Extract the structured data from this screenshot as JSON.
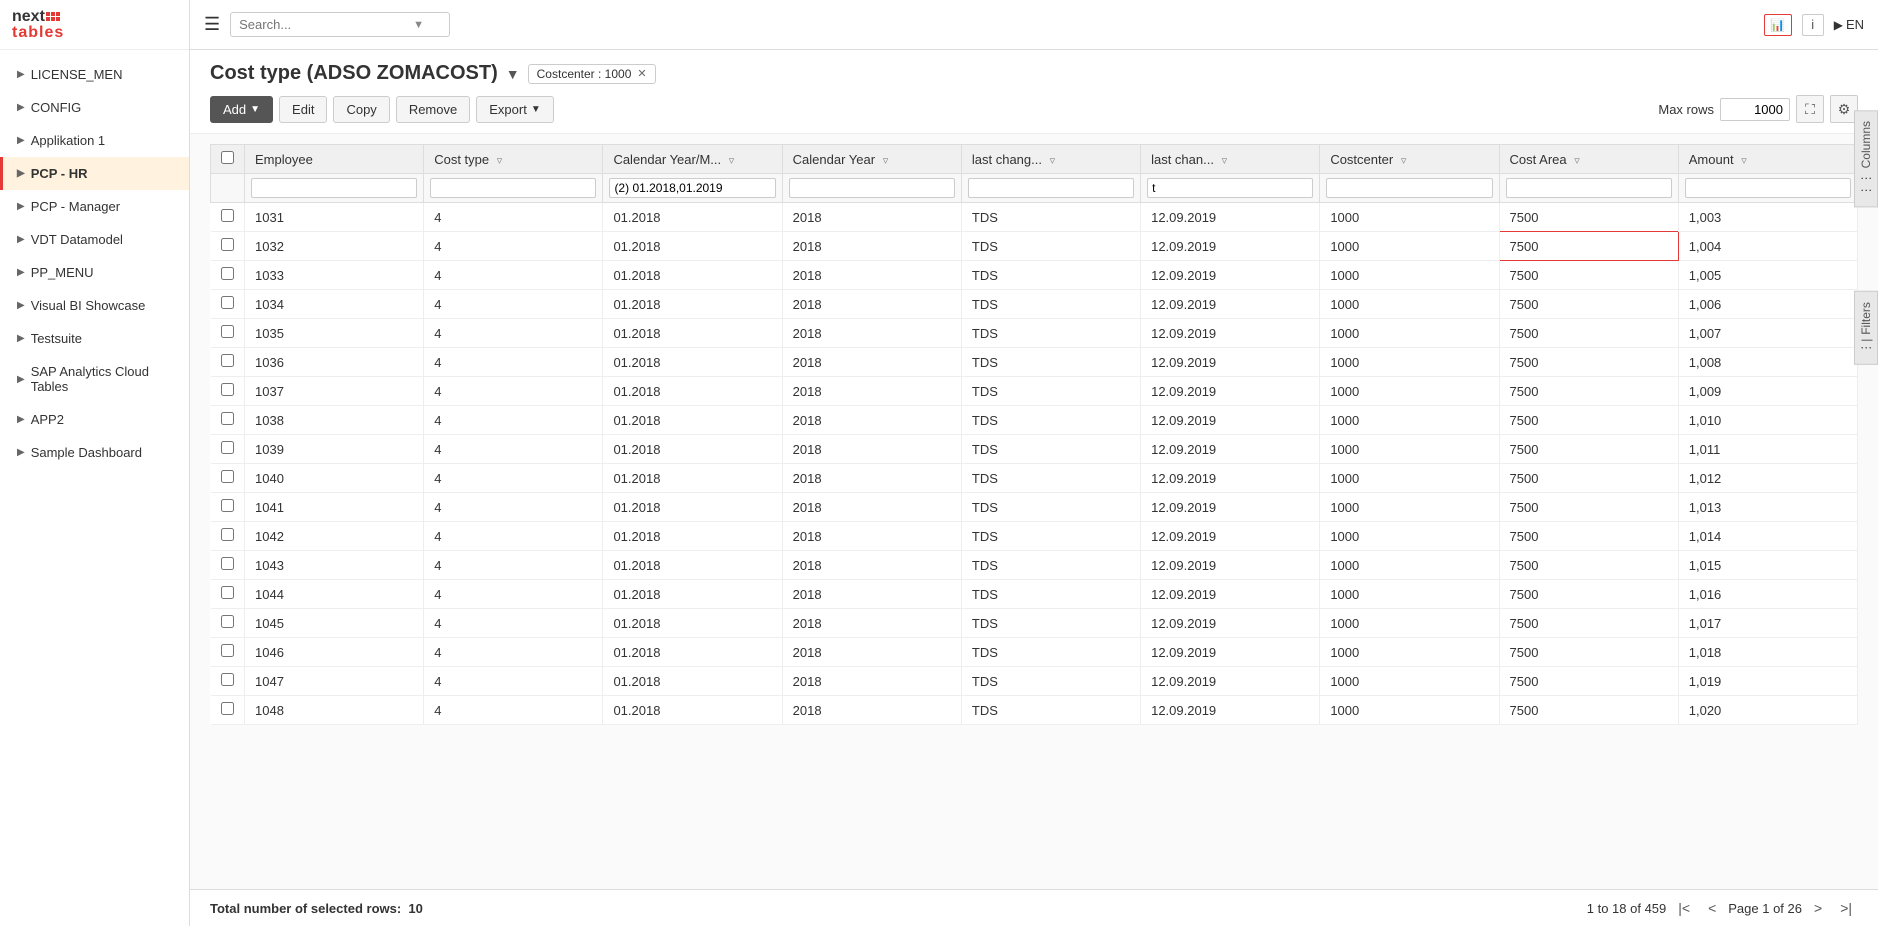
{
  "logo": {
    "next": "next",
    "tables": "tables"
  },
  "topbar": {
    "search_placeholder": "Search...",
    "lang": "EN"
  },
  "sidebar": {
    "items": [
      {
        "id": "license-men",
        "label": "LICENSE_MEN",
        "active": false
      },
      {
        "id": "config",
        "label": "CONFIG",
        "active": false
      },
      {
        "id": "applikation-1",
        "label": "Applikation 1",
        "active": false
      },
      {
        "id": "pcp-hr",
        "label": "PCP - HR",
        "active": true
      },
      {
        "id": "pcp-manager",
        "label": "PCP - Manager",
        "active": false
      },
      {
        "id": "vdt-datamodel",
        "label": "VDT Datamodel",
        "active": false
      },
      {
        "id": "pp-menu",
        "label": "PP_MENU",
        "active": false
      },
      {
        "id": "visual-bi-showcase",
        "label": "Visual BI Showcase",
        "active": false
      },
      {
        "id": "testsuite",
        "label": "Testsuite",
        "active": false
      },
      {
        "id": "sap-analytics-cloud-tables",
        "label": "SAP Analytics Cloud Tables",
        "active": false
      },
      {
        "id": "app2",
        "label": "APP2",
        "active": false
      },
      {
        "id": "sample-dashboard",
        "label": "Sample Dashboard",
        "active": false
      }
    ]
  },
  "page": {
    "title": "Cost type (ADSO ZOMACOST)",
    "filter_badge": "Costcenter : 1000"
  },
  "toolbar": {
    "add_label": "Add",
    "edit_label": "Edit",
    "copy_label": "Copy",
    "remove_label": "Remove",
    "export_label": "Export",
    "max_rows_label": "Max rows",
    "max_rows_value": "1000"
  },
  "table": {
    "columns": [
      {
        "id": "employee",
        "label": "Employee"
      },
      {
        "id": "cost-type",
        "label": "Cost type"
      },
      {
        "id": "calendar-year-month",
        "label": "Calendar Year/M..."
      },
      {
        "id": "calendar-year",
        "label": "Calendar Year"
      },
      {
        "id": "last-changed-by",
        "label": "last chang..."
      },
      {
        "id": "last-changed-on",
        "label": "last chan..."
      },
      {
        "id": "costcenter",
        "label": "Costcenter"
      },
      {
        "id": "cost-area",
        "label": "Cost Area"
      },
      {
        "id": "amount",
        "label": "Amount"
      }
    ],
    "filter_row": {
      "calendar_year_month_filter": "(2) 01.2018,01.2019",
      "last_changed_on_filter": "t"
    },
    "rows": [
      {
        "employee": "1031",
        "cost_type": "4",
        "cal_year_month": "01.2018",
        "cal_year": "2018",
        "last_changed_by": "TDS",
        "last_changed_on": "12.09.2019",
        "costcenter": "1000",
        "cost_area": "7500",
        "amount": "1,003"
      },
      {
        "employee": "1032",
        "cost_type": "4",
        "cal_year_month": "01.2018",
        "cal_year": "2018",
        "last_changed_by": "TDS",
        "last_changed_on": "12.09.2019",
        "costcenter": "1000",
        "cost_area": "7500",
        "amount": "1,004",
        "highlighted": true
      },
      {
        "employee": "1033",
        "cost_type": "4",
        "cal_year_month": "01.2018",
        "cal_year": "2018",
        "last_changed_by": "TDS",
        "last_changed_on": "12.09.2019",
        "costcenter": "1000",
        "cost_area": "7500",
        "amount": "1,005"
      },
      {
        "employee": "1034",
        "cost_type": "4",
        "cal_year_month": "01.2018",
        "cal_year": "2018",
        "last_changed_by": "TDS",
        "last_changed_on": "12.09.2019",
        "costcenter": "1000",
        "cost_area": "7500",
        "amount": "1,006"
      },
      {
        "employee": "1035",
        "cost_type": "4",
        "cal_year_month": "01.2018",
        "cal_year": "2018",
        "last_changed_by": "TDS",
        "last_changed_on": "12.09.2019",
        "costcenter": "1000",
        "cost_area": "7500",
        "amount": "1,007"
      },
      {
        "employee": "1036",
        "cost_type": "4",
        "cal_year_month": "01.2018",
        "cal_year": "2018",
        "last_changed_by": "TDS",
        "last_changed_on": "12.09.2019",
        "costcenter": "1000",
        "cost_area": "7500",
        "amount": "1,008"
      },
      {
        "employee": "1037",
        "cost_type": "4",
        "cal_year_month": "01.2018",
        "cal_year": "2018",
        "last_changed_by": "TDS",
        "last_changed_on": "12.09.2019",
        "costcenter": "1000",
        "cost_area": "7500",
        "amount": "1,009"
      },
      {
        "employee": "1038",
        "cost_type": "4",
        "cal_year_month": "01.2018",
        "cal_year": "2018",
        "last_changed_by": "TDS",
        "last_changed_on": "12.09.2019",
        "costcenter": "1000",
        "cost_area": "7500",
        "amount": "1,010"
      },
      {
        "employee": "1039",
        "cost_type": "4",
        "cal_year_month": "01.2018",
        "cal_year": "2018",
        "last_changed_by": "TDS",
        "last_changed_on": "12.09.2019",
        "costcenter": "1000",
        "cost_area": "7500",
        "amount": "1,011"
      },
      {
        "employee": "1040",
        "cost_type": "4",
        "cal_year_month": "01.2018",
        "cal_year": "2018",
        "last_changed_by": "TDS",
        "last_changed_on": "12.09.2019",
        "costcenter": "1000",
        "cost_area": "7500",
        "amount": "1,012"
      },
      {
        "employee": "1041",
        "cost_type": "4",
        "cal_year_month": "01.2018",
        "cal_year": "2018",
        "last_changed_by": "TDS",
        "last_changed_on": "12.09.2019",
        "costcenter": "1000",
        "cost_area": "7500",
        "amount": "1,013"
      },
      {
        "employee": "1042",
        "cost_type": "4",
        "cal_year_month": "01.2018",
        "cal_year": "2018",
        "last_changed_by": "TDS",
        "last_changed_on": "12.09.2019",
        "costcenter": "1000",
        "cost_area": "7500",
        "amount": "1,014"
      },
      {
        "employee": "1043",
        "cost_type": "4",
        "cal_year_month": "01.2018",
        "cal_year": "2018",
        "last_changed_by": "TDS",
        "last_changed_on": "12.09.2019",
        "costcenter": "1000",
        "cost_area": "7500",
        "amount": "1,015"
      },
      {
        "employee": "1044",
        "cost_type": "4",
        "cal_year_month": "01.2018",
        "cal_year": "2018",
        "last_changed_by": "TDS",
        "last_changed_on": "12.09.2019",
        "costcenter": "1000",
        "cost_area": "7500",
        "amount": "1,016"
      },
      {
        "employee": "1045",
        "cost_type": "4",
        "cal_year_month": "01.2018",
        "cal_year": "2018",
        "last_changed_by": "TDS",
        "last_changed_on": "12.09.2019",
        "costcenter": "1000",
        "cost_area": "7500",
        "amount": "1,017"
      },
      {
        "employee": "1046",
        "cost_type": "4",
        "cal_year_month": "01.2018",
        "cal_year": "2018",
        "last_changed_by": "TDS",
        "last_changed_on": "12.09.2019",
        "costcenter": "1000",
        "cost_area": "7500",
        "amount": "1,018"
      },
      {
        "employee": "1047",
        "cost_type": "4",
        "cal_year_month": "01.2018",
        "cal_year": "2018",
        "last_changed_by": "TDS",
        "last_changed_on": "12.09.2019",
        "costcenter": "1000",
        "cost_area": "7500",
        "amount": "1,019"
      },
      {
        "employee": "1048",
        "cost_type": "4",
        "cal_year_month": "01.2018",
        "cal_year": "2018",
        "last_changed_by": "TDS",
        "last_changed_on": "12.09.2019",
        "costcenter": "1000",
        "cost_area": "7500",
        "amount": "1,020"
      }
    ]
  },
  "pagination": {
    "range_text": "1 to 18 of 459",
    "page_text": "Page 1 of 26"
  },
  "footer": {
    "total_label": "Total number of selected rows:",
    "total_value": "10"
  },
  "side_panels": {
    "columns_label": "Columns",
    "filters_label": "Filters"
  }
}
